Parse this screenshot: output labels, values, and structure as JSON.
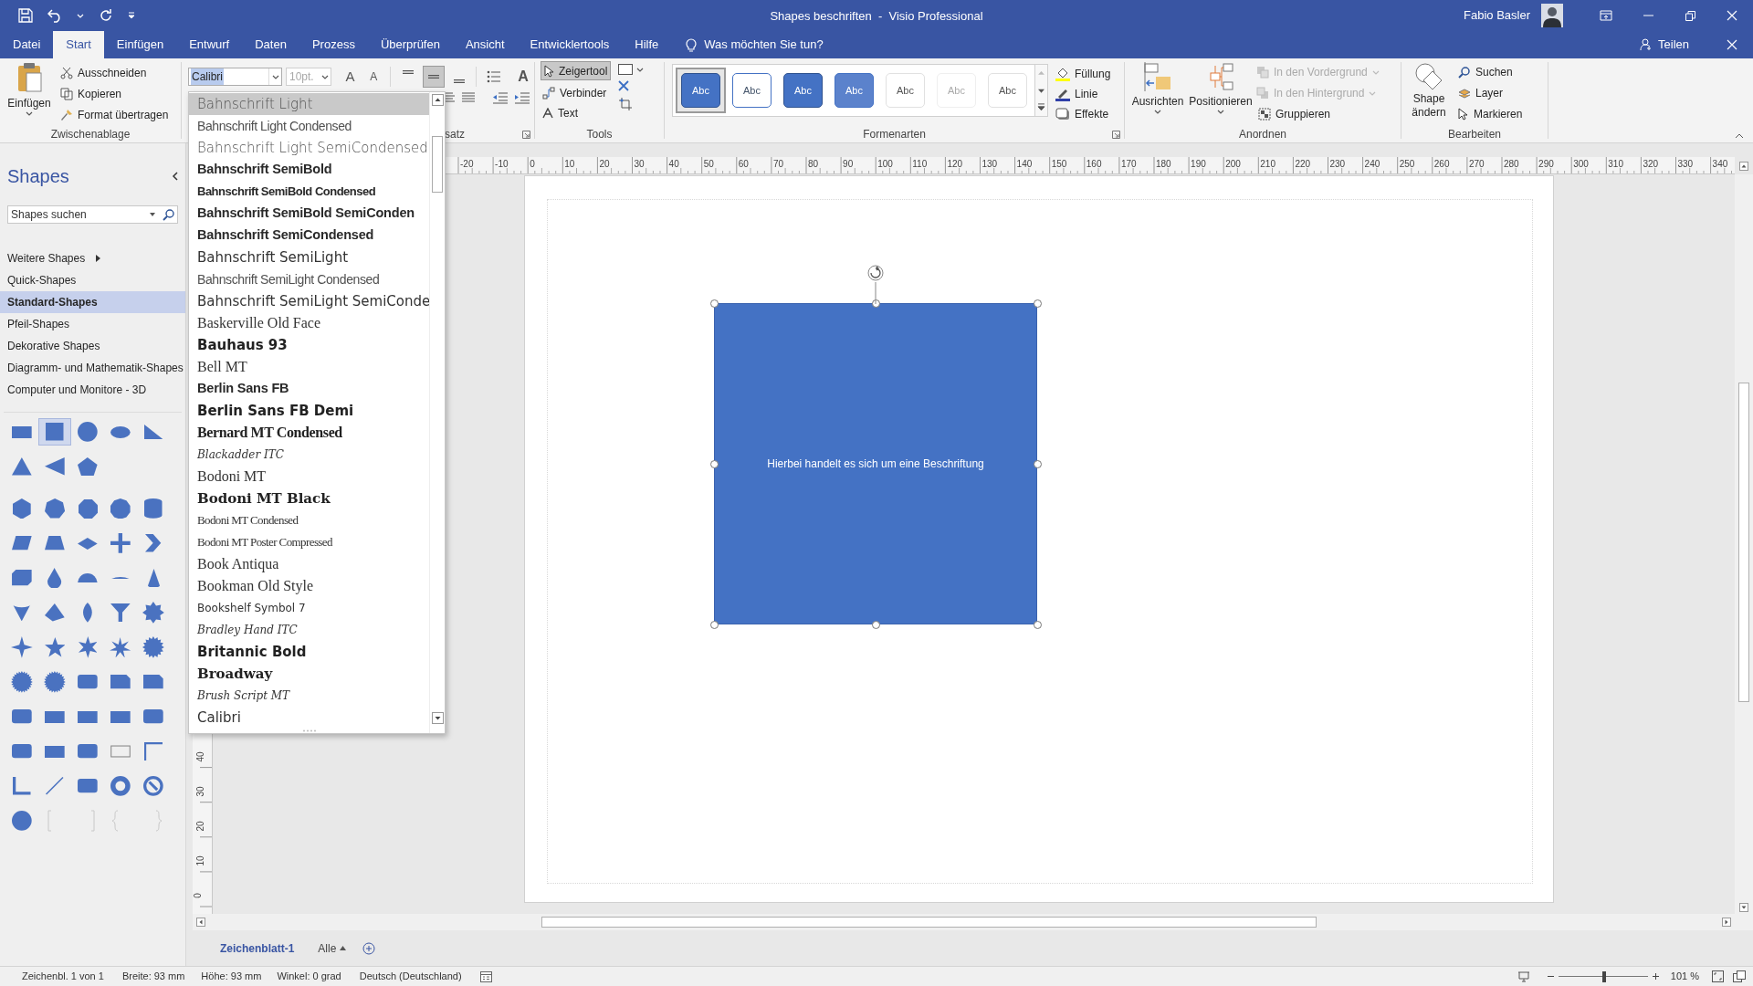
{
  "window": {
    "title": "Shapes beschriften  -  Visio Professional",
    "user": "Fabio Basler"
  },
  "ribbon_tabs": [
    {
      "label": "Datei",
      "selected": false
    },
    {
      "label": "Start",
      "selected": true
    },
    {
      "label": "Einfügen",
      "selected": false
    },
    {
      "label": "Entwurf",
      "selected": false
    },
    {
      "label": "Daten",
      "selected": false
    },
    {
      "label": "Prozess",
      "selected": false
    },
    {
      "label": "Überprüfen",
      "selected": false
    },
    {
      "label": "Ansicht",
      "selected": false
    },
    {
      "label": "Entwicklertools",
      "selected": false
    },
    {
      "label": "Hilfe",
      "selected": false
    }
  ],
  "tell_me": "Was möchten Sie tun?",
  "share": "Teilen",
  "ribbon": {
    "clipboard": {
      "paste": "Einfügen",
      "cut": "Ausschneiden",
      "copy": "Kopieren",
      "format_painter": "Format übertragen",
      "label": "Zwischenablage"
    },
    "font": {
      "name": "Calibri",
      "size": "10pt.",
      "grow": "A",
      "shrink": "A",
      "rotate": "A",
      "paragraph_label": "satz",
      "alignment": [
        {
          "kind": "top",
          "selected": false
        },
        {
          "kind": "middle",
          "selected": true
        },
        {
          "kind": "bottom",
          "selected": false
        }
      ]
    },
    "tools": {
      "pointer": {
        "label": "Zeigertool",
        "selected": true
      },
      "connector": "Verbinder",
      "text": "Text",
      "label": "Tools"
    },
    "shape_styles": {
      "items": [
        {
          "label": "Abc",
          "kind": "filled",
          "selected": true
        },
        {
          "label": "Abc",
          "kind": "outline",
          "selected": false
        },
        {
          "label": "Abc",
          "kind": "filled",
          "selected": false
        },
        {
          "label": "Abc",
          "kind": "medium",
          "selected": false
        },
        {
          "label": "Abc",
          "kind": "plain",
          "selected": false
        },
        {
          "label": "Abc",
          "kind": "faint",
          "selected": false
        },
        {
          "label": "Abc",
          "kind": "plain",
          "selected": false
        }
      ],
      "fill": "Füllung",
      "line": "Linie",
      "effects": "Effekte",
      "label": "Formenarten"
    },
    "arrange": {
      "align": "Ausrichten",
      "position": "Positionieren",
      "front": {
        "label": "In den Vordergrund",
        "disabled": true
      },
      "back": {
        "label": "In den Hintergrund",
        "disabled": true
      },
      "group": "Gruppieren",
      "label": "Anordnen"
    },
    "editing": {
      "change_shape": "Shape ändern",
      "find": "Suchen",
      "layer": "Layer",
      "select": "Markieren",
      "label": "Bearbeiten"
    }
  },
  "font_list": {
    "items": [
      {
        "label": "Bahnschrift Light",
        "kind": "light",
        "selected": true
      },
      {
        "label": "Bahnschrift Light Condensed",
        "kind": "lightcondensed",
        "selected": false
      },
      {
        "label": "Bahnschrift Light SemiCondensed",
        "kind": "light",
        "selected": false
      },
      {
        "label": "Bahnschrift SemiBold",
        "kind": "bold",
        "selected": false
      },
      {
        "label": "Bahnschrift SemiBold Condensed",
        "kind": "boldcondensed",
        "selected": false
      },
      {
        "label": "Bahnschrift SemiBold SemiConden",
        "kind": "bold",
        "selected": false
      },
      {
        "label": "Bahnschrift SemiCondensed",
        "kind": "bold",
        "selected": false
      },
      {
        "label": "Bahnschrift SemiLight",
        "kind": "regular",
        "selected": false
      },
      {
        "label": "Bahnschrift SemiLight Condensed",
        "kind": "lightcondensed",
        "selected": false
      },
      {
        "label": "Bahnschrift SemiLight SemiConde",
        "kind": "regular",
        "selected": false
      },
      {
        "label": "Baskerville Old Face",
        "kind": "serif",
        "selected": false
      },
      {
        "label": "Bauhaus 93",
        "kind": "heavy",
        "selected": false
      },
      {
        "label": "Bell MT",
        "kind": "serif",
        "selected": false
      },
      {
        "label": "Berlin Sans FB",
        "kind": "bold",
        "selected": false
      },
      {
        "label": "Berlin Sans FB Demi",
        "kind": "heavy",
        "selected": false
      },
      {
        "label": "Bernard MT Condensed",
        "kind": "condensedserif",
        "selected": false
      },
      {
        "label": "Blackadder ITC",
        "kind": "script",
        "selected": false
      },
      {
        "label": "Bodoni MT",
        "kind": "serif",
        "selected": false
      },
      {
        "label": "Bodoni MT Black",
        "kind": "serifbold",
        "selected": false
      },
      {
        "label": "Bodoni MT Condensed",
        "kind": "narrowserif",
        "selected": false
      },
      {
        "label": "Bodoni MT Poster Compressed",
        "kind": "narrowserif",
        "selected": false
      },
      {
        "label": "Book Antiqua",
        "kind": "serif",
        "selected": false
      },
      {
        "label": "Bookman Old Style",
        "kind": "serif",
        "selected": false
      },
      {
        "label": "Bookshelf Symbol 7",
        "kind": "small",
        "selected": false
      },
      {
        "label": "Bradley Hand ITC",
        "kind": "script",
        "selected": false
      },
      {
        "label": "Britannic Bold",
        "kind": "heavy",
        "selected": false
      },
      {
        "label": "Broadway",
        "kind": "serifbold",
        "selected": false
      },
      {
        "label": "Brush Script MT",
        "kind": "script",
        "selected": false
      },
      {
        "label": "Calibri",
        "kind": "regular",
        "selected": false
      }
    ]
  },
  "shapes_panel": {
    "title": "Shapes",
    "search": {
      "placeholder": "Shapes suchen"
    },
    "stencils": [
      {
        "label": "Weitere Shapes",
        "kind": "submenu",
        "selected": false
      },
      {
        "label": "Quick-Shapes",
        "kind": "stencil",
        "selected": false
      },
      {
        "label": "Standard-Shapes",
        "kind": "stencil",
        "selected": true
      },
      {
        "label": "Pfeil-Shapes",
        "kind": "stencil",
        "selected": false
      },
      {
        "label": "Dekorative Shapes",
        "kind": "stencil",
        "selected": false
      },
      {
        "label": "Diagramm- und Mathematik-Shapes",
        "kind": "stencil",
        "selected": false
      },
      {
        "label": "Computer und Monitore - 3D",
        "kind": "stencil",
        "selected": false
      }
    ],
    "groups": [
      {
        "shapes": [
          {
            "kind": "rect",
            "selected": false
          },
          {
            "kind": "square",
            "selected": true
          },
          {
            "kind": "circle",
            "selected": false
          },
          {
            "kind": "ellipse",
            "selected": false
          },
          {
            "kind": "wedge",
            "selected": false
          },
          {
            "kind": "triangle",
            "selected": false
          },
          {
            "kind": "arrowhead",
            "selected": false
          },
          {
            "kind": "pentagon",
            "selected": false
          }
        ]
      },
      {
        "shapes": [
          {
            "kind": "hexagon",
            "selected": false
          },
          {
            "kind": "heptagon",
            "selected": false
          },
          {
            "kind": "octagon",
            "selected": false
          },
          {
            "kind": "decagon",
            "selected": false
          },
          {
            "kind": "can",
            "selected": false
          },
          {
            "kind": "parallelogram",
            "selected": false
          },
          {
            "kind": "trapezoid",
            "selected": false
          },
          {
            "kind": "diamond",
            "selected": false
          },
          {
            "kind": "cross",
            "selected": false
          },
          {
            "kind": "chevron",
            "selected": false
          },
          {
            "kind": "cube",
            "selected": false
          },
          {
            "kind": "drop",
            "selected": false
          },
          {
            "kind": "semicircle",
            "selected": false
          },
          {
            "kind": "segment",
            "selected": false
          },
          {
            "kind": "cone",
            "selected": false
          },
          {
            "kind": "invertedcone",
            "selected": false
          },
          {
            "kind": "pyramid",
            "selected": false
          },
          {
            "kind": "lens",
            "selected": false
          },
          {
            "kind": "funnel",
            "selected": false
          },
          {
            "kind": "gear",
            "selected": false
          },
          {
            "kind": "star4",
            "selected": false
          },
          {
            "kind": "star5",
            "selected": false
          },
          {
            "kind": "star6",
            "selected": false
          },
          {
            "kind": "star7",
            "selected": false
          },
          {
            "kind": "seal",
            "selected": false
          },
          {
            "kind": "burst",
            "selected": false
          },
          {
            "kind": "burst",
            "selected": false
          },
          {
            "kind": "roundrect",
            "selected": false
          },
          {
            "kind": "snip",
            "selected": false
          },
          {
            "kind": "snip",
            "selected": false
          },
          {
            "kind": "roundrect",
            "selected": false
          },
          {
            "kind": "rect",
            "selected": false
          },
          {
            "kind": "rect",
            "selected": false
          },
          {
            "kind": "rect",
            "selected": false
          },
          {
            "kind": "roundrect",
            "selected": false
          },
          {
            "kind": "roundrect",
            "selected": false
          },
          {
            "kind": "rect",
            "selected": false
          },
          {
            "kind": "roundrect",
            "selected": false
          },
          {
            "kind": "frame",
            "selected": false
          },
          {
            "kind": "corner",
            "selected": false
          },
          {
            "kind": "lshape",
            "selected": false
          },
          {
            "kind": "line",
            "selected": false
          },
          {
            "kind": "roundrect",
            "selected": false
          },
          {
            "kind": "donut",
            "selected": false
          },
          {
            "kind": "nosign",
            "selected": false
          },
          {
            "kind": "circle",
            "selected": false
          },
          {
            "kind": "bracket",
            "selected": false
          },
          {
            "kind": "brace",
            "selected": false
          }
        ]
      }
    ]
  },
  "rulers": {
    "horizontal": [
      "-20",
      "-10",
      "0",
      "10",
      "20",
      "30",
      "40",
      "50",
      "60",
      "70",
      "80",
      "90",
      "100",
      "110",
      "120",
      "130",
      "140",
      "150",
      "160",
      "170",
      "180",
      "190",
      "200",
      "210",
      "220",
      "230",
      "240",
      "250",
      "260",
      "270",
      "280",
      "290",
      "300",
      "310",
      "320",
      "330",
      "340"
    ],
    "vertical": [
      "0",
      "10",
      "20",
      "30",
      "40"
    ]
  },
  "shape": {
    "text": "Hierbei handelt es sich um eine Beschriftung",
    "selected": true
  },
  "sheets": [
    {
      "label": "Zeichenblatt-1",
      "selected": true
    }
  ],
  "all_pages": "Alle",
  "status_bar": {
    "items": [
      "Zeichenbl. 1 von 1",
      "Breite: 93 mm",
      "Höhe: 93 mm",
      "Winkel: 0 grad",
      "Deutsch (Deutschland)"
    ],
    "zoom": {
      "level": 0.51,
      "reading": "101 %"
    }
  }
}
